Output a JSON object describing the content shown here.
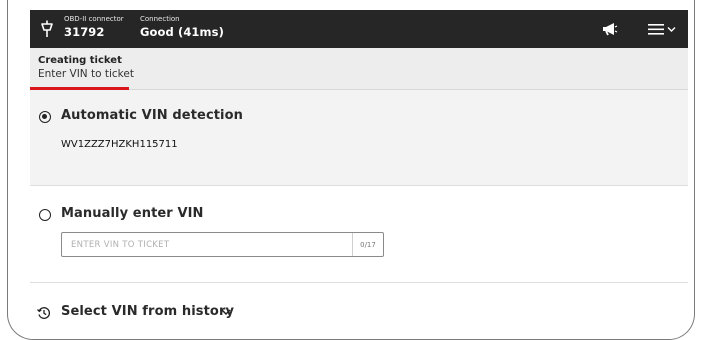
{
  "topbar": {
    "obd_label": "OBD-II connector",
    "obd_value": "31792",
    "connection_label": "Connection",
    "connection_value": "Good (41ms)",
    "icons": [
      "obd-connector-icon",
      "megaphone-icon",
      "menu-icon",
      "chevron-down-icon"
    ]
  },
  "subheader": {
    "title": "Creating ticket",
    "subtitle": "Enter VIN to ticket",
    "progress_fraction": 0.15,
    "accent_color": "#d9151b"
  },
  "options": {
    "automatic": {
      "label": "Automatic VIN detection",
      "selected": true,
      "vin": "WV1ZZZ7HZKH115711"
    },
    "manual": {
      "label": "Manually enter VIN",
      "selected": false,
      "input_value": "",
      "placeholder": "ENTER VIN TO TICKET",
      "counter": "0/17"
    },
    "history": {
      "label": "Select VIN from history",
      "icon": "history-icon"
    }
  },
  "colors": {
    "topbar_bg": "#262626",
    "subheader_bg": "#ededed",
    "selected_option_bg": "#f3f3f3"
  }
}
